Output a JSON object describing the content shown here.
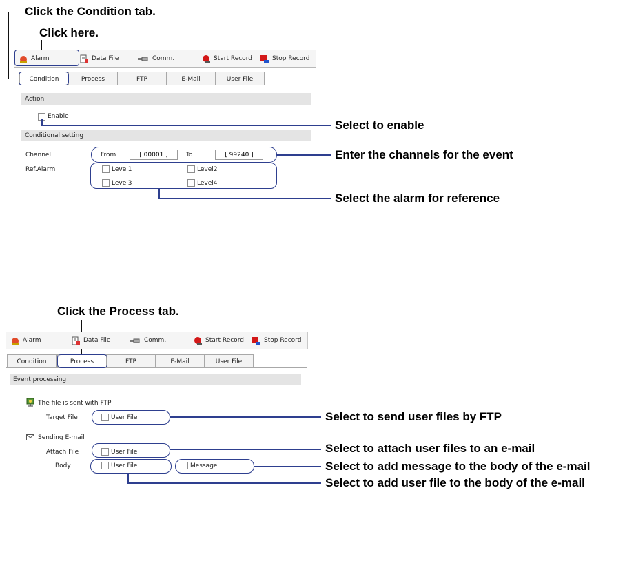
{
  "callouts": {
    "condition_tab": "Click the Condition tab.",
    "click_here": "Click here.",
    "enable": "Select to enable",
    "channels": "Enter the channels for the event",
    "alarm_ref": "Select the alarm for reference",
    "process_tab": "Click the Process tab.",
    "ftp_send": "Select to send user files by FTP",
    "attach": "Select to attach user files to an e-mail",
    "body_message": "Select to add message to the body of the e-mail",
    "body_user_file": "Select to add user file to the body of the e-mail"
  },
  "toolbar": {
    "alarm": "Alarm",
    "data_file": "Data File",
    "comm": "Comm.",
    "start_record": "Start Record",
    "stop_record": "Stop Record"
  },
  "tabs": [
    "Condition",
    "Process",
    "FTP",
    "E-Mail",
    "User File"
  ],
  "condition_panel": {
    "action_header": "Action",
    "enable_label": "Enable",
    "conditional_header": "Conditional setting",
    "channel_label": "Channel",
    "from_label": "From",
    "from_value": "[ 00001 ]",
    "to_label": "To",
    "to_value": "[ 99240 ]",
    "ref_alarm_label": "Ref.Alarm",
    "levels": [
      "Level1",
      "Level2",
      "Level3",
      "Level4"
    ]
  },
  "process_panel": {
    "header": "Event processing",
    "ftp_label": "The file is sent with FTP",
    "target_file_label": "Target File",
    "target_file_option": "User File",
    "email_label": "Sending E-mail",
    "attach_file_label": "Attach File",
    "attach_file_option": "User File",
    "body_label": "Body",
    "body_user_file_option": "User File",
    "body_message_option": "Message"
  },
  "colors": {
    "highlight": "#2e3f8f",
    "section_bg": "#e4e4e4",
    "toolbar_bg": "#f5f5f5"
  }
}
